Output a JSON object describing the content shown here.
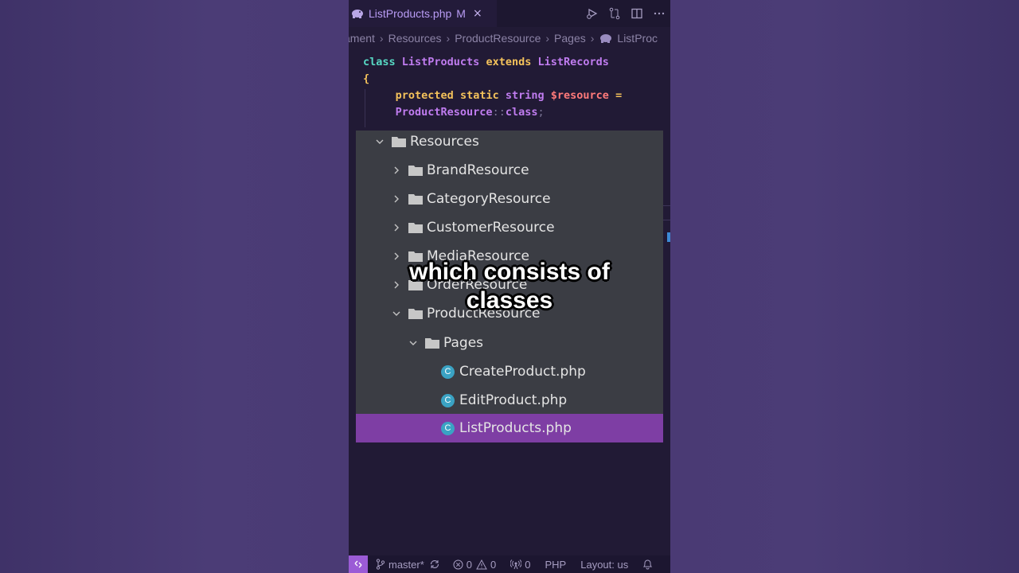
{
  "tab": {
    "filename": "ListProducts.php",
    "modified": "M",
    "close": "×"
  },
  "breadcrumb": [
    "ament",
    "Resources",
    "ProductResource",
    "Pages",
    "ListProc"
  ],
  "code": {
    "line1": {
      "kw": "class",
      "name": "ListProducts",
      "extends": "extends",
      "parent": "ListRecords"
    },
    "line2": "{",
    "line3": {
      "protected": "protected",
      "static": "static",
      "type": "string",
      "var": "$resource",
      "eq": "="
    },
    "line4": {
      "cls": "ProductResource",
      "dc": "::",
      "kw": "class",
      "semi": ";"
    }
  },
  "tree": [
    {
      "label": "Resources",
      "type": "folder",
      "expanded": true
    },
    {
      "label": "BrandResource",
      "type": "folder",
      "expanded": false
    },
    {
      "label": "CategoryResource",
      "type": "folder",
      "expanded": false
    },
    {
      "label": "CustomerResource",
      "type": "folder",
      "expanded": false
    },
    {
      "label": "MediaResource",
      "type": "folder",
      "expanded": false
    },
    {
      "label": "OrderResource",
      "type": "folder",
      "expanded": false
    },
    {
      "label": "ProductResource",
      "type": "folder",
      "expanded": true
    },
    {
      "label": "Pages",
      "type": "folder",
      "expanded": true
    },
    {
      "label": "CreateProduct.php",
      "type": "class-file"
    },
    {
      "label": "EditProduct.php",
      "type": "class-file"
    },
    {
      "label": "ListProducts.php",
      "type": "class-file",
      "selected": true
    }
  ],
  "caption": {
    "line1": "which consists of",
    "line2": "classes"
  },
  "status": {
    "branch": "master*",
    "errors": "0",
    "warnings": "0",
    "ports": "0",
    "language": "PHP",
    "layout": "Layout: us"
  },
  "colors": {
    "accent": "#7e3ea4",
    "editor_bg": "#211a35",
    "tree_bg": "#3b3d44",
    "remote": "#9b5bd6"
  }
}
